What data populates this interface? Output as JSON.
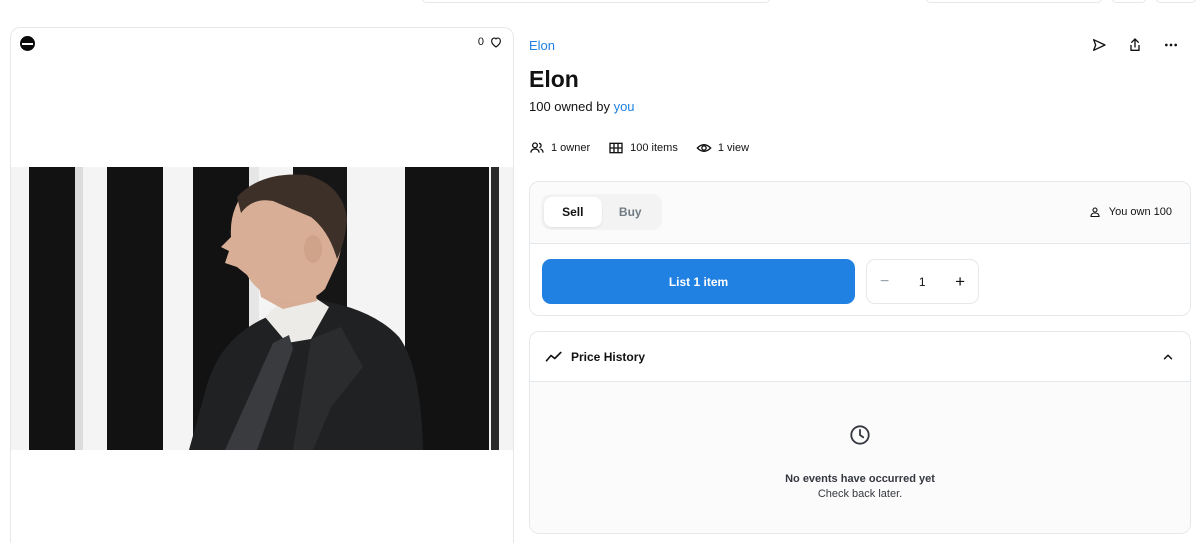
{
  "media": {
    "favorite_count": "0"
  },
  "item": {
    "collection": "Elon",
    "name": "Elon",
    "owned_prefix": "100 owned by ",
    "owned_by": "you"
  },
  "stats": {
    "owners": "1 owner",
    "items": "100 items",
    "views": "1 view"
  },
  "trade": {
    "tabs": [
      "Sell",
      "Buy"
    ],
    "active_tab": "Sell",
    "you_own": "You own 100",
    "list_button": "List 1 item",
    "quantity": "1",
    "minus": "−",
    "plus": "+"
  },
  "price_history": {
    "title": "Price History",
    "empty_title": "No events have occurred yet",
    "empty_sub": "Check back later."
  },
  "icons": {
    "chain": "chain-icon",
    "favorite": "heart-icon",
    "send": "send-icon",
    "share": "share-icon",
    "more": "more-icon",
    "owners": "people-icon",
    "items": "grid-icon",
    "views": "eye-icon",
    "person": "person-icon",
    "trend": "trending-icon",
    "collapse": "chevron-up-icon",
    "empty": "clock-icon"
  },
  "colors": {
    "accent": "#2081e2",
    "text": "#121212",
    "border": "#e5e8eb"
  }
}
